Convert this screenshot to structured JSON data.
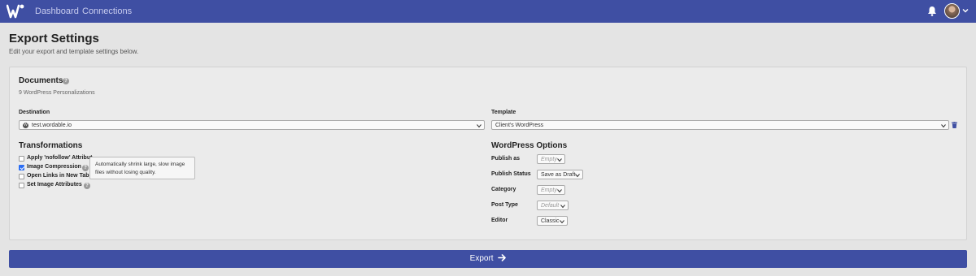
{
  "nav": {
    "dashboard": "Dashboard",
    "connections": "Connections"
  },
  "header": {
    "title": "Export Settings",
    "subtitle": "Edit your export and template settings below."
  },
  "documents": {
    "title": "Documents",
    "count_text": "9 WordPress Personalizations"
  },
  "destination": {
    "label": "Destination",
    "value": "test.wordable.io"
  },
  "template": {
    "label": "Template",
    "value": "Client's WordPress"
  },
  "transformations": {
    "title": "Transformations",
    "items": [
      {
        "label": "Apply 'nofollow' Attribut",
        "checked": false
      },
      {
        "label": "Image Compression",
        "checked": true
      },
      {
        "label": "Open Links in New Tab",
        "checked": false
      },
      {
        "label": "Set Image Attributes",
        "checked": false
      }
    ],
    "tooltip": "Automatically shrink large, slow image files without losing quality."
  },
  "wp_options": {
    "title": "WordPress Options",
    "publish_as": {
      "label": "Publish as",
      "value": "Empty"
    },
    "publish_status": {
      "label": "Publish Status",
      "value": "Save as Draft"
    },
    "category": {
      "label": "Category",
      "value": "Empty"
    },
    "post_type": {
      "label": "Post Type",
      "value": "Default"
    },
    "editor": {
      "label": "Editor",
      "value": "Classic"
    }
  },
  "export_button": {
    "label": "Export"
  },
  "colors": {
    "primary": "#3f4fa3",
    "checkbox": "#2a6df4",
    "trash": "#3f4fa3"
  },
  "icons": [
    "wordable-logo-icon",
    "bell-icon",
    "avatar",
    "chevron-down-icon",
    "help-icon",
    "wordpress-icon",
    "trash-icon",
    "arrow-right-icon"
  ]
}
